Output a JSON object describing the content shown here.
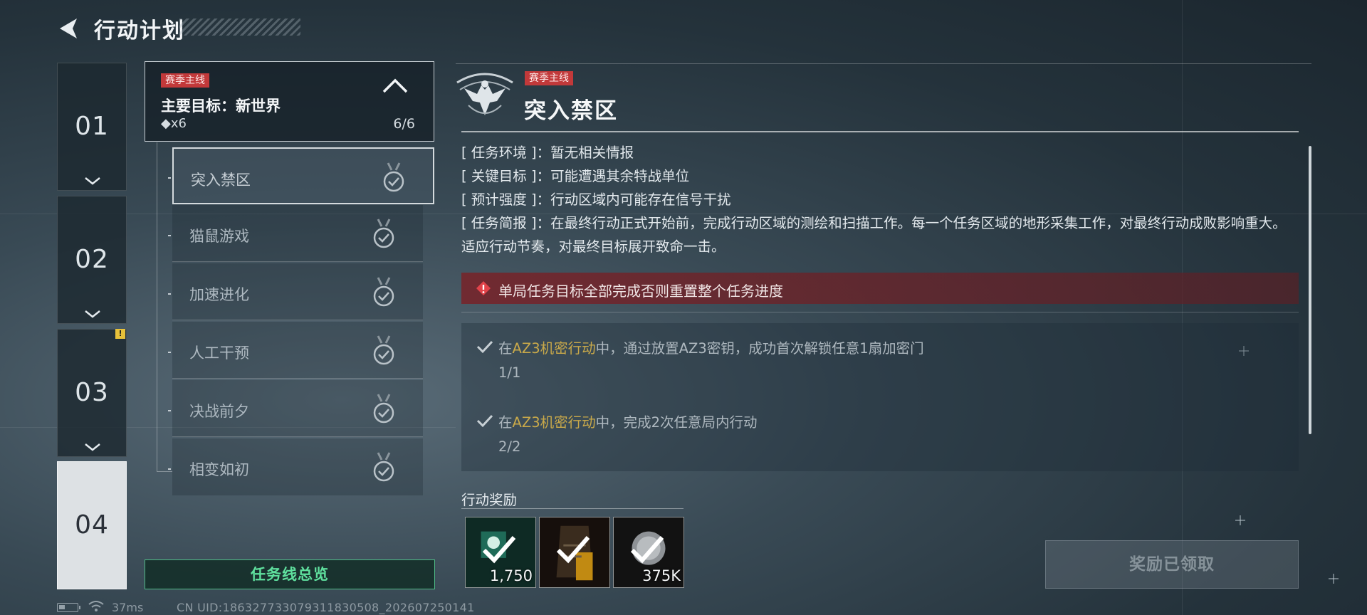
{
  "header": {
    "title": "行动计划"
  },
  "chapters": [
    {
      "label": "01",
      "active": false,
      "alert": false
    },
    {
      "label": "02",
      "active": false,
      "alert": false
    },
    {
      "label": "03",
      "active": false,
      "alert": true,
      "alert_mark": "!"
    },
    {
      "label": "04",
      "active": true,
      "alert": false
    }
  ],
  "mission_group": {
    "tag": "赛季主线",
    "name": "主要目标：新世界",
    "reward": "◆x6",
    "progress": "6/6"
  },
  "tasks": [
    {
      "label": "突入禁区",
      "selected": true,
      "done": true
    },
    {
      "label": "猫鼠游戏",
      "selected": false,
      "done": true
    },
    {
      "label": "加速进化",
      "selected": false,
      "done": true
    },
    {
      "label": "人工干预",
      "selected": false,
      "done": true
    },
    {
      "label": "决战前夕",
      "selected": false,
      "done": true
    },
    {
      "label": "相变如初",
      "selected": false,
      "done": true
    }
  ],
  "overview_button": "任务线总览",
  "mission": {
    "tag": "赛季主线",
    "title": "突入禁区",
    "info": [
      {
        "key": "[ 任务环境 ]：",
        "value": "暂无相关情报"
      },
      {
        "key": "[ 关键目标 ]：",
        "value": "可能遭遇其余特战单位"
      },
      {
        "key": "[ 预计强度 ]：",
        "value": "行动区域内可能存在信号干扰"
      },
      {
        "key": "[ 任务简报 ]：",
        "value": "在最终行动正式开始前，完成行动区域的测绘和扫描工作。每一个任务区域的地形采集工作，对最终行动成败影响重大。适应行动节奏，对最终目标展开致命一击。"
      }
    ],
    "warning": "单局任务目标全部完成否则重置整个任务进度",
    "objectives": [
      {
        "prefix": "在",
        "highlight": "AZ3机密行动",
        "suffix": "中，通过放置AZ3密钥，成功首次解锁任意1扇加密门",
        "count": "1/1"
      },
      {
        "prefix": "在",
        "highlight": "AZ3机密行动",
        "suffix": "中，完成2次任意局内行动",
        "count": "2/2"
      }
    ]
  },
  "rewards": {
    "title": "行动奖励",
    "items": [
      {
        "icon": "currency-chip-icon",
        "qty": "1,750"
      },
      {
        "icon": "tactical-vest-icon",
        "qty": ""
      },
      {
        "icon": "coin-icon",
        "qty": "375K"
      }
    ],
    "claim_label": "奖励已领取"
  },
  "status": {
    "ping": "37ms",
    "uid": "CN UID:1863277330793118305‌08_202607250141"
  },
  "colors": {
    "accent_green": "#5fe09e",
    "tag_red": "#c2393a",
    "highlight_gold": "#c9a94a",
    "alert_yellow": "#e8c23a"
  }
}
